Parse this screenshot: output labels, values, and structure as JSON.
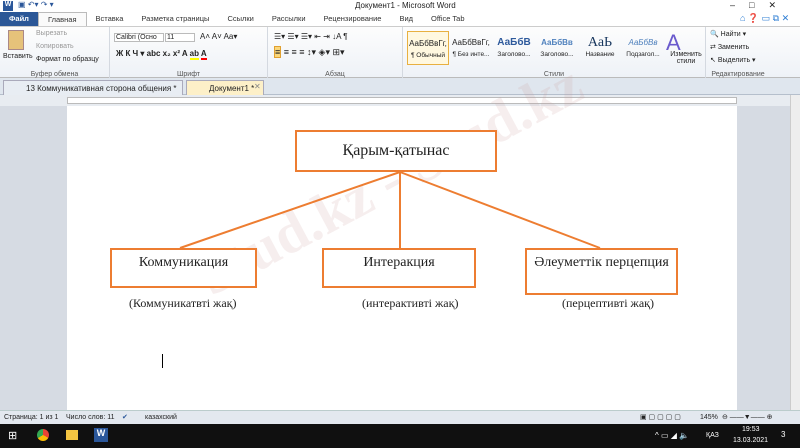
{
  "window": {
    "title": "Документ1 - Microsoft Word"
  },
  "ribbon_tabs": [
    "Файл",
    "Главная",
    "Вставка",
    "Разметка страницы",
    "Ссылки",
    "Рассылки",
    "Рецензирование",
    "Вид",
    "Office Tab"
  ],
  "clipboard": {
    "paste": "Вставить",
    "cut": "Вырезать",
    "copy": "Копировать",
    "format": "Формат по образцу",
    "label": "Буфер обмена"
  },
  "font": {
    "name": "Calibri (Осно",
    "size": "11",
    "label": "Шрифт"
  },
  "paragraph": {
    "label": "Абзац"
  },
  "styles": {
    "items": [
      {
        "sample": "АаБбВвГг,",
        "name": "¶ Обычный"
      },
      {
        "sample": "АаБбВвГг,",
        "name": "¶ Без инте..."
      },
      {
        "sample": "АаБбВ",
        "name": "Заголово..."
      },
      {
        "sample": "АаБбВв",
        "name": "Заголово..."
      },
      {
        "sample": "АаЬ",
        "name": "Название"
      },
      {
        "sample": "АаБбВв",
        "name": "Подзагол..."
      }
    ],
    "change": "Изменить стили",
    "label": "Стили"
  },
  "editing": {
    "find": "Найти",
    "replace": "Заменить",
    "select": "Выделить",
    "label": "Редактирование"
  },
  "doc_tabs": [
    "13 Коммуникативная сторона общения *",
    "Документ1 *"
  ],
  "diagram": {
    "top": "Қарым-қатынас",
    "boxes": [
      "Коммуникация",
      "Интеракция",
      "Әлеуметтік перцепция"
    ],
    "captions": [
      "(Коммуникатвті жақ)",
      "(интерактивті жақ)",
      "(перцептивті жақ)"
    ]
  },
  "watermark": "Stud.kz - Stud.kz",
  "status": {
    "page": "Страница: 1 из 1",
    "words": "Число слов: 11",
    "lang": "казахский",
    "zoom": "145%"
  },
  "taskbar": {
    "lang": "ҚАЗ",
    "time": "19:53",
    "date": "13.03.2021",
    "notifications": "3"
  }
}
